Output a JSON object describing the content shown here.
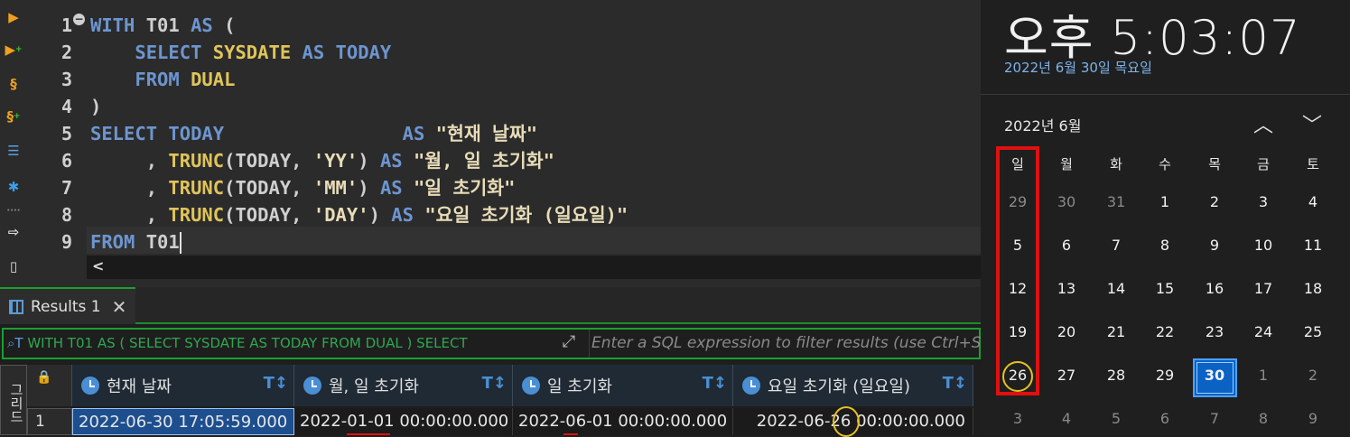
{
  "editor": {
    "lines": [
      {
        "n": "1",
        "tokens": [
          [
            "WITH ",
            "kw"
          ],
          [
            "T01 ",
            "pl"
          ],
          [
            "AS ",
            "kw"
          ],
          [
            "(",
            "pl"
          ]
        ]
      },
      {
        "n": "2",
        "tokens": [
          [
            "    SELECT ",
            "kw"
          ],
          [
            "SYSDATE ",
            "fn"
          ],
          [
            "AS ",
            "kw"
          ],
          [
            "TODAY",
            "kw"
          ]
        ]
      },
      {
        "n": "3",
        "tokens": [
          [
            "    FROM ",
            "kw"
          ],
          [
            "DUAL",
            "fn"
          ]
        ]
      },
      {
        "n": "4",
        "tokens": [
          [
            ")",
            "pl"
          ]
        ]
      },
      {
        "n": "5",
        "tokens": [
          [
            "SELECT ",
            "kw"
          ],
          [
            "TODAY",
            "kw"
          ],
          [
            "                ",
            "pl"
          ],
          [
            "AS ",
            "kw"
          ],
          [
            "\"현재 날짜\"",
            "st"
          ]
        ]
      },
      {
        "n": "6",
        "tokens": [
          [
            "     , ",
            "pl"
          ],
          [
            "TRUNC",
            "fn"
          ],
          [
            "(TODAY, ",
            "pl"
          ],
          [
            "'YY'",
            "st"
          ],
          [
            ") ",
            "pl"
          ],
          [
            "AS ",
            "kw"
          ],
          [
            "\"월, 일 초기화\"",
            "st"
          ]
        ]
      },
      {
        "n": "7",
        "tokens": [
          [
            "     , ",
            "pl"
          ],
          [
            "TRUNC",
            "fn"
          ],
          [
            "(TODAY, ",
            "pl"
          ],
          [
            "'MM'",
            "st"
          ],
          [
            ") ",
            "pl"
          ],
          [
            "AS ",
            "kw"
          ],
          [
            "\"일 초기화\"",
            "st"
          ]
        ]
      },
      {
        "n": "8",
        "tokens": [
          [
            "     , ",
            "pl"
          ],
          [
            "TRUNC",
            "fn"
          ],
          [
            "(TODAY, ",
            "pl"
          ],
          [
            "'DAY'",
            "st"
          ],
          [
            ") ",
            "pl"
          ],
          [
            "AS ",
            "kw"
          ],
          [
            "\"요일 초기화 (일요일)\"",
            "st"
          ]
        ]
      },
      {
        "n": "9",
        "tokens": [
          [
            "FROM ",
            "kw"
          ],
          [
            "T01",
            "pl"
          ]
        ]
      }
    ]
  },
  "toolbar_icons": [
    "execute-statement-icon",
    "execute-in-new-tab-icon",
    "execute-script-icon",
    "execute-script-new-tab-icon",
    "explain-plan-icon",
    "settings-icon",
    "export-icon",
    "load-file-icon"
  ],
  "scroll_left": "<",
  "results": {
    "tab_label": "Results 1",
    "tab_close": "✕",
    "filter_sql": "WITH T01 AS ( SELECT SYSDATE AS TODAY FROM DUAL ) SELECT",
    "filter_placeholder": "Enter a SQL expression to filter results (use Ctrl+Space)",
    "vertical_tab": "그리드",
    "columns": [
      "현재 날짜",
      "월, 일 초기화",
      "일 초기화",
      "요일 초기화 (일요일)"
    ],
    "row_number": "1",
    "row": [
      "2022-06-30 17:05:59.000",
      "2022-01-01 00:00:00.000",
      "2022-06-01 00:00:00.000",
      "2022-06-26 00:00:00.000"
    ]
  },
  "clock": {
    "time": "오후 5:03:07",
    "date": "2022년 6월 30일 목요일",
    "month_label": "2022년 6월",
    "nav_up": "︿",
    "nav_down": "﹀",
    "weekdays": [
      "일",
      "월",
      "화",
      "수",
      "목",
      "금",
      "토"
    ],
    "weeks": [
      [
        "29",
        "30",
        "31",
        "1",
        "2",
        "3",
        "4"
      ],
      [
        "5",
        "6",
        "7",
        "8",
        "9",
        "10",
        "11"
      ],
      [
        "12",
        "13",
        "14",
        "15",
        "16",
        "17",
        "18"
      ],
      [
        "19",
        "20",
        "21",
        "22",
        "23",
        "24",
        "25"
      ],
      [
        "26",
        "27",
        "28",
        "29",
        "30",
        "1",
        "2"
      ],
      [
        "3",
        "4",
        "5",
        "6",
        "7",
        "8",
        "9"
      ]
    ],
    "today": "30",
    "accent": "#0a62c4"
  },
  "colors": {
    "keyword": "#6d95cf",
    "function": "#e0c45a",
    "string": "#e8dcb8",
    "highlight_box": "#e01010",
    "highlight_circle": "#e8c020"
  }
}
